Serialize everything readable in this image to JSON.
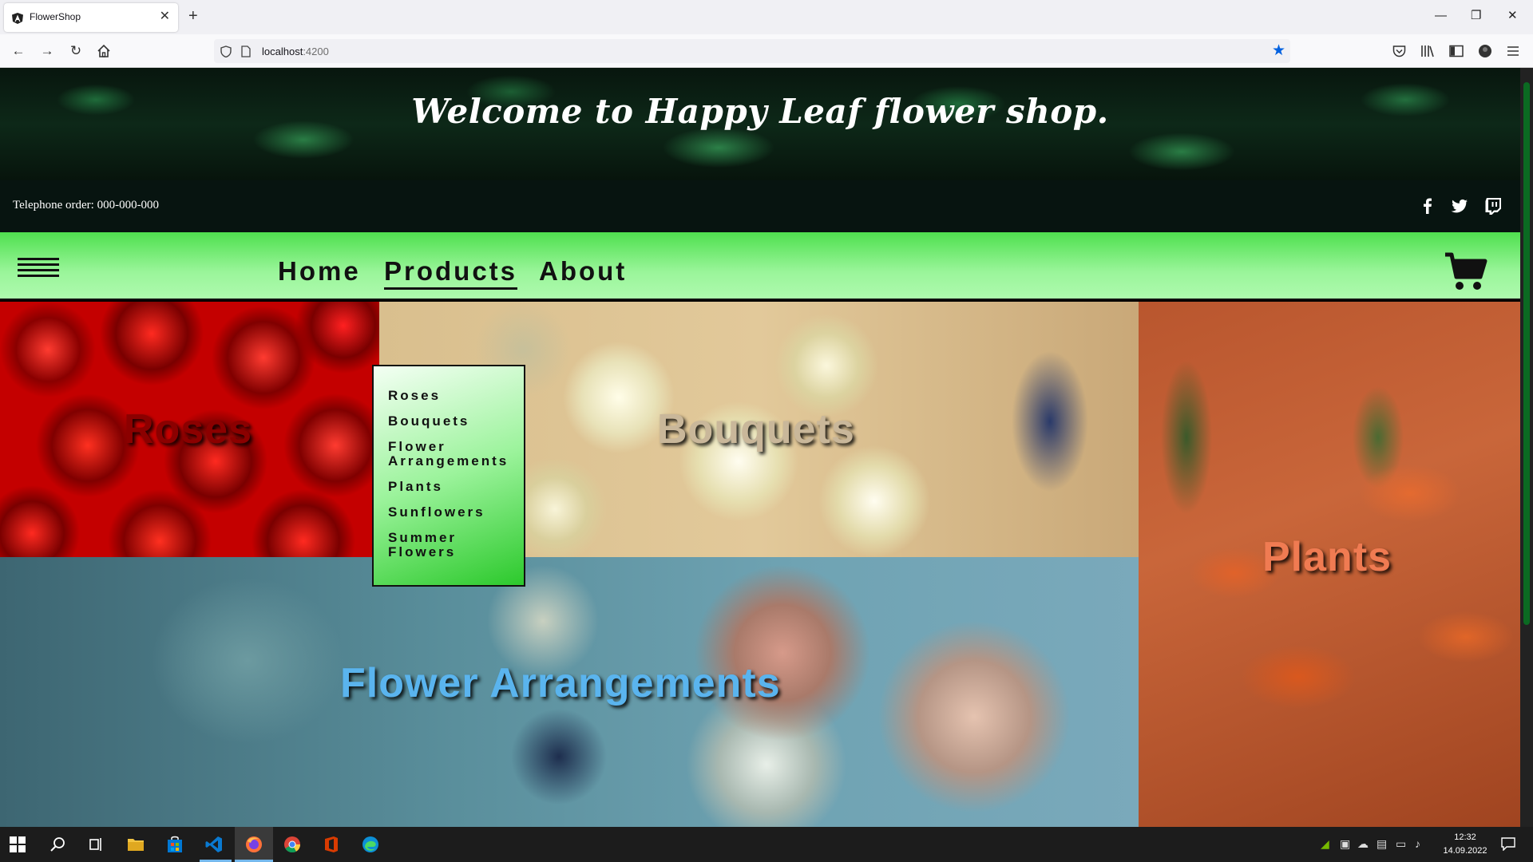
{
  "browser": {
    "tab_title": "FlowerShop",
    "tab_close": "✕",
    "new_tab": "+",
    "url_host": "localhost",
    "url_port": ":4200",
    "window_controls": [
      "—",
      "❐",
      "✕"
    ]
  },
  "site": {
    "hero_title": "Welcome to Happy Leaf flower shop.",
    "phone": "Telephone order: 000-000-000",
    "social_icons": [
      "facebook-icon",
      "twitter-icon",
      "twitch-icon"
    ],
    "menu": {
      "home": "Home",
      "products": "Products",
      "about": "About"
    },
    "dropdown": [
      "Roses",
      "Bouquets",
      "Flower Arrangements",
      "Plants",
      "Sunflowers",
      "Summer Flowers"
    ],
    "tiles": {
      "roses": "Roses",
      "bouquets": "Bouquets",
      "plants": "Plants",
      "arrangements": "Flower Arrangements"
    },
    "colors": {
      "menu_green": "#4fe04f",
      "roses_label": "#8b0000",
      "bouquets_label": "#c9b79a",
      "plants_label": "#f07b52",
      "arrangements_label": "#5ab4ee"
    }
  },
  "taskbar": {
    "time": "12:32",
    "date": "14.09.2022",
    "apps": [
      "windows-start-icon",
      "search-icon",
      "task-view-icon",
      "file-explorer-icon",
      "store-icon",
      "vscode-icon",
      "firefox-icon",
      "chrome-icon",
      "office-icon",
      "edge-icon"
    ]
  }
}
